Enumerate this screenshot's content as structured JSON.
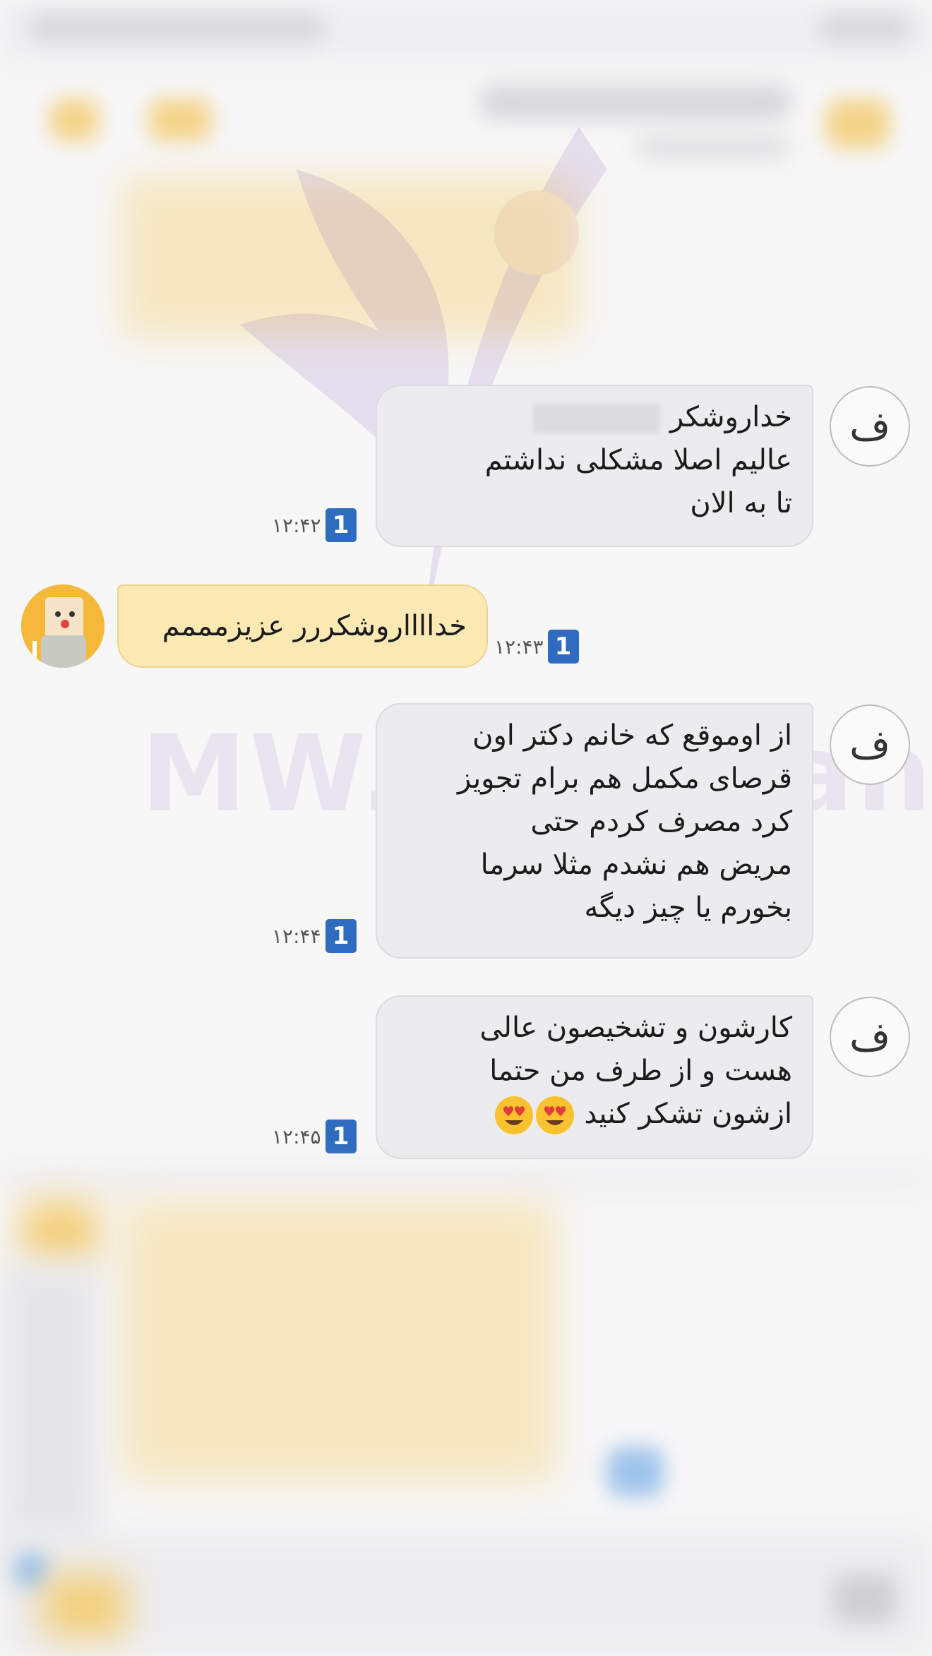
{
  "watermark": {
    "text": "MW.Mahdian"
  },
  "avatars": {
    "contact_letter": "ف"
  },
  "messages": [
    {
      "id": "m1",
      "direction": "incoming",
      "lines": [
        "خداروشکر",
        "عالیم اصلا مشکلی نداشتم",
        "تا به الان"
      ],
      "time": "۱۲:۴۲",
      "seen_count": "1"
    },
    {
      "id": "m2",
      "direction": "outgoing",
      "lines": [
        "خدااااروشکررر عزیزمممم"
      ],
      "time": "۱۲:۴۳",
      "seen_count": "1"
    },
    {
      "id": "m3",
      "direction": "incoming",
      "lines": [
        "از اوموقع که خانم دکتر اون",
        "قرصای مکمل هم برام تجویز",
        "کرد مصرف کردم حتی",
        "مریض هم نشدم مثلا سرما",
        "بخورم یا چیز دیگه"
      ],
      "time": "۱۲:۴۴",
      "seen_count": "1"
    },
    {
      "id": "m4",
      "direction": "incoming",
      "lines": [
        "کارشون و تشخیصون عالی",
        "هست و از طرف من حتما",
        "ازشون تشکر کنید"
      ],
      "time": "۱۲:۴۵",
      "seen_count": "1",
      "emoji": [
        "heart-eyes-emoji",
        "heart-eyes-emoji"
      ]
    }
  ],
  "colors": {
    "background": "#f7f7f8",
    "incoming_bubble": "#ececee",
    "outgoing_bubble": "#fde9b4",
    "seen_badge": "#2f6bbf",
    "watermark": "#7a4fb5"
  }
}
